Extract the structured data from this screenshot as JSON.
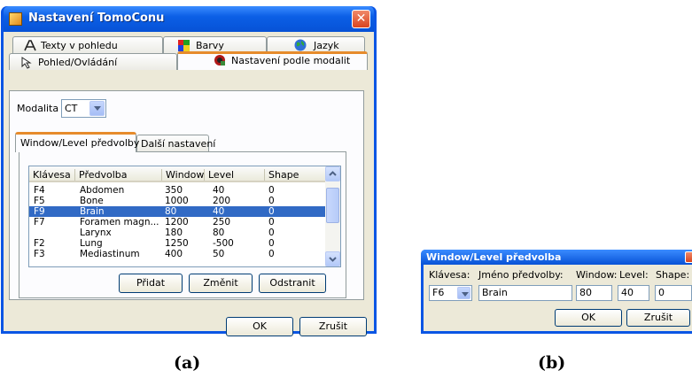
{
  "window": {
    "title": "Nastavení TomoConu",
    "close_glyph": "✕",
    "tabs": {
      "texty": "Texty v pohledu",
      "barvy": "Barvy",
      "jazyk": "Jazyk",
      "pohled": "Pohled/Ovládání",
      "nastaveni": "Nastavení podle modalit"
    },
    "modalita_label": "Modalita",
    "modalita_value": "CT",
    "subtabs": {
      "window_level": "Window/Level předvolby",
      "dalsi": "Další nastavení"
    },
    "list": {
      "headers": [
        "Klávesa",
        "Předvolba",
        "Window",
        "Level",
        "Shape"
      ],
      "rows": [
        [
          "F4",
          "Abdomen",
          "350",
          "40",
          "0"
        ],
        [
          "F5",
          "Bone",
          "1000",
          "200",
          "0"
        ],
        [
          "F9",
          "Brain",
          "80",
          "40",
          "0"
        ],
        [
          "F7",
          "Foramen magn...",
          "1200",
          "250",
          "0"
        ],
        [
          "",
          "Larynx",
          "180",
          "80",
          "0"
        ],
        [
          "F2",
          "Lung",
          "1250",
          "-500",
          "0"
        ],
        [
          "F3",
          "Mediastinum",
          "400",
          "50",
          "0"
        ]
      ],
      "selected_row_index": 2
    },
    "buttons": {
      "pridat": "Přidat",
      "zmenit": "Změnit",
      "odstranit": "Odstranit",
      "ok": "OK",
      "zrusit": "Zrušit"
    }
  },
  "dialog": {
    "title": "Window/Level předvolba",
    "labels": {
      "klavesa": "Klávesa:",
      "jmeno": "Jméno předvolby:",
      "window": "Window:",
      "level": "Level:",
      "shape": "Shape:"
    },
    "values": {
      "klavesa": "F6",
      "jmeno": "Brain",
      "window": "80",
      "level": "40",
      "shape": "0"
    },
    "buttons": {
      "ok": "OK",
      "zrusit": "Zrušit"
    }
  },
  "captions": {
    "a": "(a)",
    "b": "(b)"
  },
  "colors": {
    "titlebar": "#0752d6",
    "selection": "#316ac5",
    "active_tab_accent": "#e68b2c",
    "dialog_bg": "#ece9d8"
  }
}
